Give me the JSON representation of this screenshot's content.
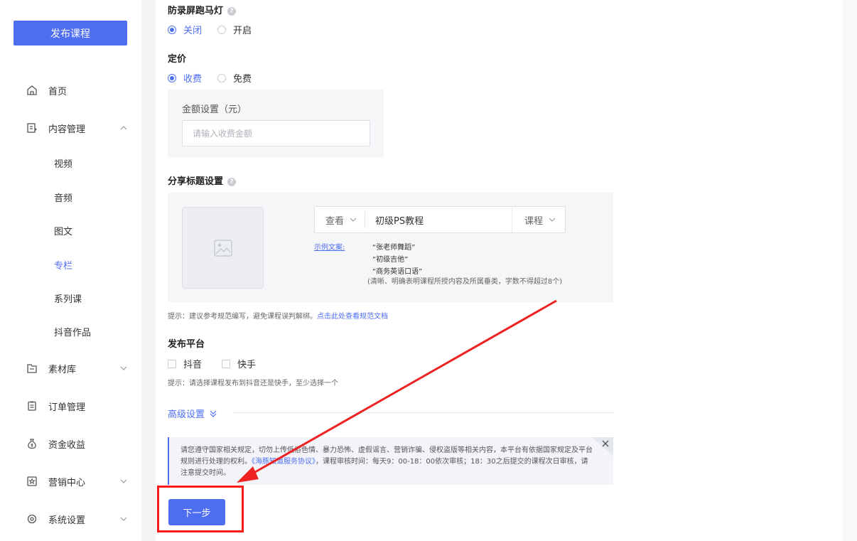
{
  "sidebar": {
    "publish_button": "发布课程",
    "items": [
      {
        "label": "首页",
        "icon": "home-icon"
      },
      {
        "label": "内容管理",
        "icon": "document-icon"
      },
      {
        "label": "素材库",
        "icon": "folder-icon"
      },
      {
        "label": "订单管理",
        "icon": "clipboard-icon"
      },
      {
        "label": "资金收益",
        "icon": "money-bag-icon"
      },
      {
        "label": "营销中心",
        "icon": "star-board-icon"
      },
      {
        "label": "系统设置",
        "icon": "gear-icon"
      }
    ],
    "sub_items": [
      {
        "label": "视频"
      },
      {
        "label": "音频"
      },
      {
        "label": "图文"
      },
      {
        "label": "专栏",
        "active": true
      },
      {
        "label": "系列课"
      },
      {
        "label": "抖音作品"
      }
    ]
  },
  "watermark": {
    "title": "防录屏跑马灯",
    "options": [
      "关闭",
      "开启"
    ],
    "selected": "关闭"
  },
  "pricing": {
    "title": "定价",
    "options": [
      "收费",
      "免费"
    ],
    "selected": "收费",
    "amount_label": "金额设置（元）",
    "amount_placeholder": "请输入收费金额"
  },
  "share_title": {
    "title": "分享标题设置",
    "prefix_select": "查看",
    "title_value": "初级PS教程",
    "suffix_select": "课程",
    "example_link": "示例文案:",
    "examples": [
      "“张老师舞蹈”",
      "“初级吉他”",
      "“商务英语口语”"
    ],
    "note": "(清晰、明确表明课程所授内容及所属垂类，字数不得超过8个)",
    "tip_prefix": "提示：建议参考规范编写，避免课程误判解绑。",
    "tip_link": "点击此处查看规范文档"
  },
  "platform": {
    "title": "发布平台",
    "options": [
      "抖音",
      "快手"
    ],
    "tip": "提示：请选择课程发布到抖音还是快手，至少选择一个"
  },
  "advanced": {
    "label": "高级设置"
  },
  "notice": {
    "text_part1": "请您遵守国家相关规定，切勿上传低俗色情、暴力恐怖、虚假谣言、营销诈骗、侵权盗版等相关内容，本平台有依据国家规定及平台规则进行处理的权利。",
    "link": "《海豚知道服务协议》",
    "text_part2": "，课程审核时间：每天9：00-18：00依次审核；18：30之后提交的课程次日审核，请注意提交时间。"
  },
  "next_button": "下一步",
  "colors": {
    "accent": "#4e6ef2",
    "highlight": "#ff1a1a",
    "arrow": "#ee2222"
  }
}
